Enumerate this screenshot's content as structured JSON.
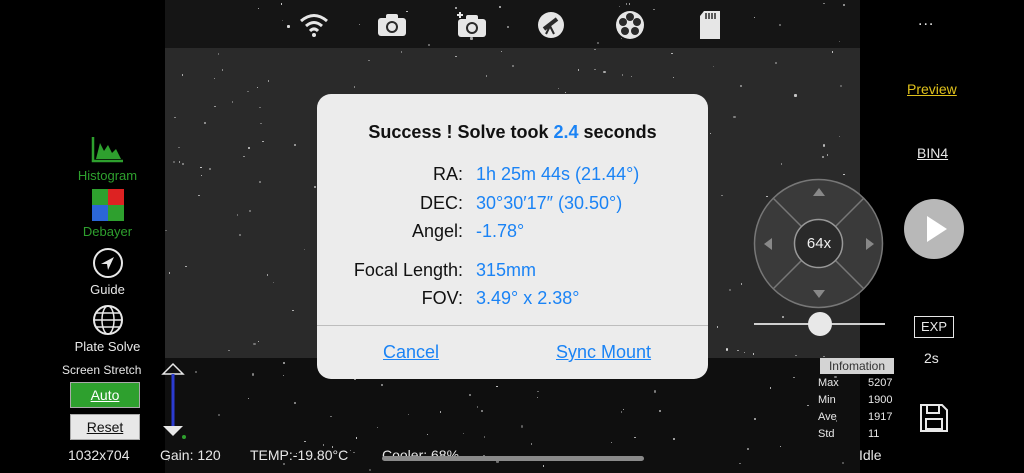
{
  "toolbar": {
    "icons": [
      "wifi-icon",
      "camera-icon",
      "camera-settings-icon",
      "telescope-icon",
      "filter-wheel-icon",
      "sd-card-icon"
    ],
    "more": "..."
  },
  "left_panel": {
    "histogram": "Histogram",
    "debayer": "Debayer",
    "guide": "Guide",
    "plate_solve": "Plate Solve",
    "screen_stretch": "Screen Stretch",
    "auto": "Auto",
    "reset": "Reset"
  },
  "status_bar": {
    "resolution": "1032x704",
    "gain": "Gain: 120",
    "temp": "TEMP:-19.80°C",
    "cooler": "Cooler: 68%",
    "state": "Idle"
  },
  "dialog": {
    "title_prefix": "Success ! Solve took",
    "title_value": "2.4",
    "title_suffix": "seconds",
    "rows": [
      {
        "label": "RA:",
        "value": "1h 25m 44s (21.44°)"
      },
      {
        "label": "DEC:",
        "value": "30°30′17″ (30.50°)"
      },
      {
        "label": "Angel:",
        "value": "-1.78°"
      },
      {
        "label": "Focal Length:",
        "value": "315mm"
      },
      {
        "label": "FOV:",
        "value": "3.49° x 2.38°"
      }
    ],
    "cancel": "Cancel",
    "sync": "Sync Mount"
  },
  "right_panel": {
    "preview": "Preview",
    "bin": "BIN4",
    "speed": "64x",
    "exp": "EXP",
    "exp_value": "2s",
    "slider_value": 0.5
  },
  "info": {
    "title": "Infomation",
    "rows": [
      {
        "label": "Max",
        "value": "5207"
      },
      {
        "label": "Min",
        "value": "1900"
      },
      {
        "label": "Ave",
        "value": "1917"
      },
      {
        "label": "Std",
        "value": "11"
      }
    ]
  },
  "colors": {
    "accent_blue": "#1a83f5",
    "green": "#2ea02e",
    "preview_yellow": "#e0c21c"
  }
}
